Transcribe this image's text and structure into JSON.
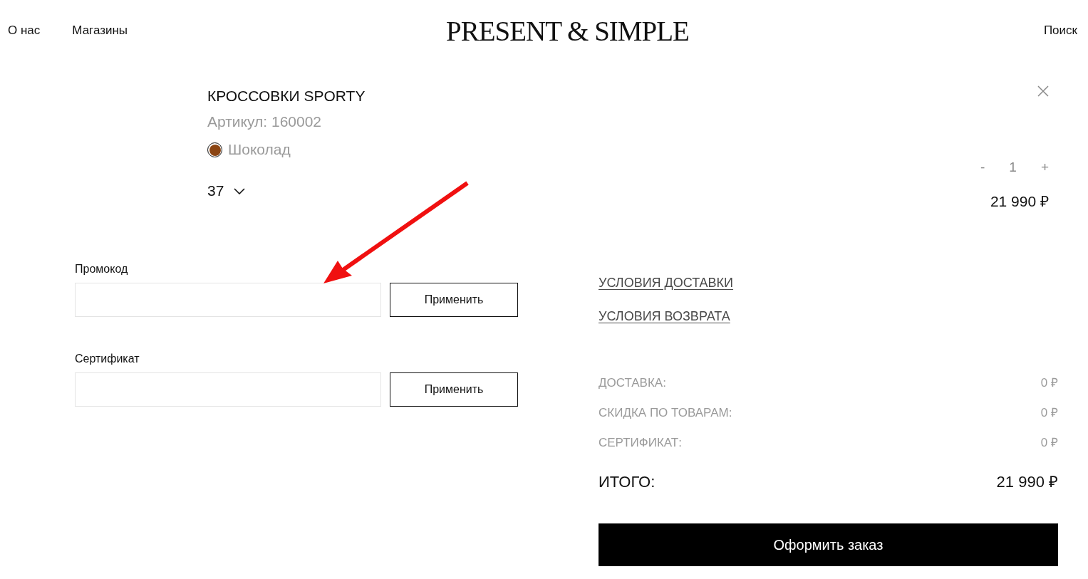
{
  "header": {
    "nav_left": [
      "О нас",
      "Магазины"
    ],
    "logo": "PRESENT & SIMPLE",
    "nav_right": [
      "Поиск"
    ]
  },
  "cart_item": {
    "title": "КРОССОВКИ SPORTY",
    "article": "Артикул: 160002",
    "color_option": {
      "name": "Шоколад",
      "color": "#8b4513"
    },
    "size": "37",
    "quantity": {
      "decrement": "-",
      "value": "1",
      "increment": "+"
    },
    "price": "21 990 ₽"
  },
  "codes": [
    {
      "label": "Промокод",
      "button": "Применить"
    },
    {
      "label": "Сертификат",
      "button": "Применить"
    }
  ],
  "links": [
    "УСЛОВИЯ ДОСТАВКИ",
    "УСЛОВИЯ ВОЗВРАТА"
  ],
  "summary": [
    {
      "kind": "line",
      "label": "ДОСТАВКА:",
      "value": "0 ₽"
    },
    {
      "kind": "line",
      "label": "СКИДКА ПО ТОВАРАМ:",
      "value": "0 ₽"
    },
    {
      "kind": "line",
      "label": "СЕРТИФИКАТ:",
      "value": "0 ₽"
    },
    {
      "kind": "total",
      "label": "ИТОГО:",
      "value": "21 990 ₽"
    }
  ],
  "checkout_button": "Оформить заказ",
  "annotations": [
    {
      "kind": "arrow"
    }
  ]
}
